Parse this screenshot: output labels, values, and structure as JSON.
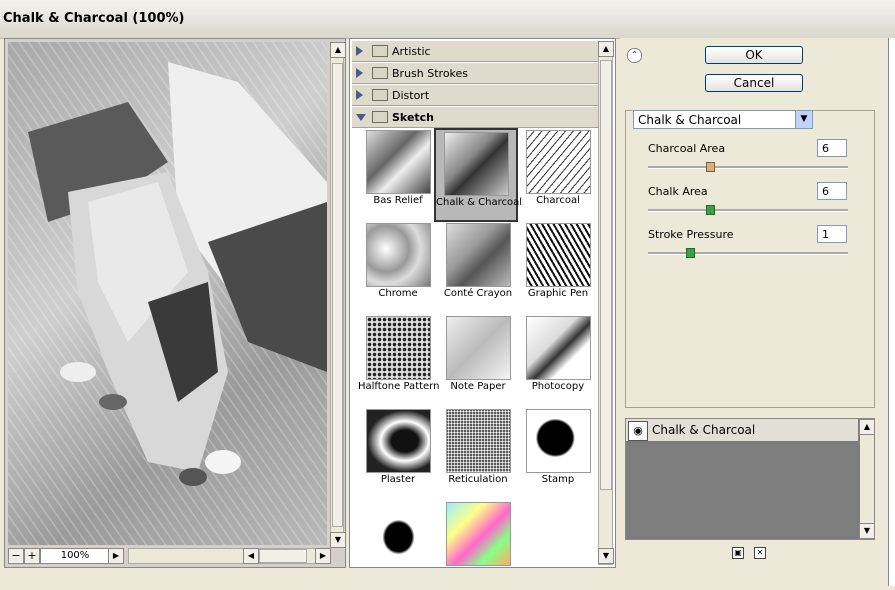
{
  "window": {
    "title": "Chalk & Charcoal (100%)"
  },
  "preview": {
    "zoom": "100%",
    "zoom_out_label": "−",
    "zoom_in_label": "+"
  },
  "categories": [
    {
      "label": "Artistic",
      "expanded": false
    },
    {
      "label": "Brush Strokes",
      "expanded": false
    },
    {
      "label": "Distort",
      "expanded": false
    },
    {
      "label": "Sketch",
      "expanded": true
    }
  ],
  "filters": [
    {
      "label": "Bas Relief",
      "selected": false
    },
    {
      "label": "Chalk & Charcoal",
      "selected": true
    },
    {
      "label": "Charcoal",
      "selected": false
    },
    {
      "label": "Chrome",
      "selected": false
    },
    {
      "label": "Conté Crayon",
      "selected": false
    },
    {
      "label": "Graphic Pen",
      "selected": false
    },
    {
      "label": "Halftone Pattern",
      "selected": false
    },
    {
      "label": "Note Paper",
      "selected": false
    },
    {
      "label": "Photocopy",
      "selected": false
    },
    {
      "label": "Plaster",
      "selected": false
    },
    {
      "label": "Reticulation",
      "selected": false
    },
    {
      "label": "Stamp",
      "selected": false
    },
    {
      "label": "",
      "selected": false
    },
    {
      "label": "",
      "selected": false
    }
  ],
  "buttons": {
    "ok": "OK",
    "cancel": "Cancel"
  },
  "settings": {
    "filter_select": "Chalk & Charcoal",
    "params": [
      {
        "label": "Charcoal Area",
        "value": "6",
        "level": 0.3
      },
      {
        "label": "Chalk Area",
        "value": "6",
        "level": 0.3
      },
      {
        "label": "Stroke Pressure",
        "value": "1",
        "level": 0.2
      }
    ]
  },
  "layers": [
    {
      "label": "Chalk & Charcoal",
      "visible": true
    }
  ],
  "icons": {
    "eye": "eye-icon",
    "new_layer": "new-effect-layer-icon",
    "delete": "trash-icon",
    "collapse": "double-chevron-up-icon"
  }
}
